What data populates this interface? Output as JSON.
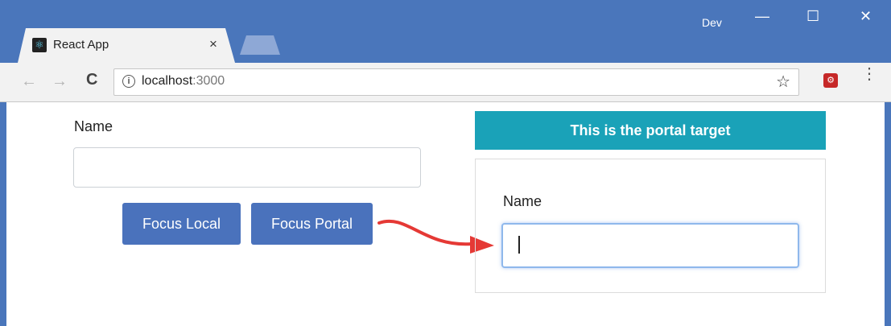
{
  "browser": {
    "tab_title": "React App",
    "tab_close": "×",
    "profile": "Dev",
    "minimize": "—",
    "maximize": "☐",
    "close": "✕",
    "url_host": "localhost",
    "url_port": ":3000",
    "back_glyph": "←",
    "forward_glyph": "→",
    "reload_glyph": "C",
    "star_glyph": "☆",
    "info_glyph": "i",
    "menu_glyph": "⋮"
  },
  "local_form": {
    "label": "Name",
    "value": ""
  },
  "buttons": {
    "focus_local": "Focus Local",
    "focus_portal": "Focus Portal"
  },
  "portal": {
    "header": "This is the portal target",
    "label": "Name",
    "value": ""
  },
  "colors": {
    "titlebar": "#4a76bb",
    "button": "#4a72bc",
    "portal_header": "#1aa2b8",
    "arrow": "#e53935"
  }
}
